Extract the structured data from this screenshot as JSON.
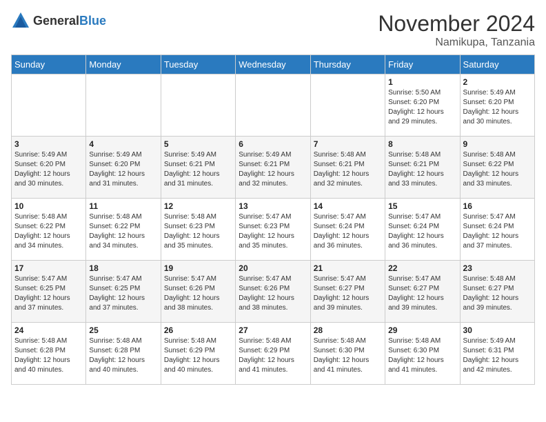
{
  "logo": {
    "general": "General",
    "blue": "Blue"
  },
  "title": "November 2024",
  "subtitle": "Namikupa, Tanzania",
  "days_header": [
    "Sunday",
    "Monday",
    "Tuesday",
    "Wednesday",
    "Thursday",
    "Friday",
    "Saturday"
  ],
  "weeks": [
    [
      {
        "day": "",
        "sunrise": "",
        "sunset": "",
        "daylight": ""
      },
      {
        "day": "",
        "sunrise": "",
        "sunset": "",
        "daylight": ""
      },
      {
        "day": "",
        "sunrise": "",
        "sunset": "",
        "daylight": ""
      },
      {
        "day": "",
        "sunrise": "",
        "sunset": "",
        "daylight": ""
      },
      {
        "day": "",
        "sunrise": "",
        "sunset": "",
        "daylight": ""
      },
      {
        "day": "1",
        "sunrise": "Sunrise: 5:50 AM",
        "sunset": "Sunset: 6:20 PM",
        "daylight": "Daylight: 12 hours and 29 minutes."
      },
      {
        "day": "2",
        "sunrise": "Sunrise: 5:49 AM",
        "sunset": "Sunset: 6:20 PM",
        "daylight": "Daylight: 12 hours and 30 minutes."
      }
    ],
    [
      {
        "day": "3",
        "sunrise": "Sunrise: 5:49 AM",
        "sunset": "Sunset: 6:20 PM",
        "daylight": "Daylight: 12 hours and 30 minutes."
      },
      {
        "day": "4",
        "sunrise": "Sunrise: 5:49 AM",
        "sunset": "Sunset: 6:20 PM",
        "daylight": "Daylight: 12 hours and 31 minutes."
      },
      {
        "day": "5",
        "sunrise": "Sunrise: 5:49 AM",
        "sunset": "Sunset: 6:21 PM",
        "daylight": "Daylight: 12 hours and 31 minutes."
      },
      {
        "day": "6",
        "sunrise": "Sunrise: 5:49 AM",
        "sunset": "Sunset: 6:21 PM",
        "daylight": "Daylight: 12 hours and 32 minutes."
      },
      {
        "day": "7",
        "sunrise": "Sunrise: 5:48 AM",
        "sunset": "Sunset: 6:21 PM",
        "daylight": "Daylight: 12 hours and 32 minutes."
      },
      {
        "day": "8",
        "sunrise": "Sunrise: 5:48 AM",
        "sunset": "Sunset: 6:21 PM",
        "daylight": "Daylight: 12 hours and 33 minutes."
      },
      {
        "day": "9",
        "sunrise": "Sunrise: 5:48 AM",
        "sunset": "Sunset: 6:22 PM",
        "daylight": "Daylight: 12 hours and 33 minutes."
      }
    ],
    [
      {
        "day": "10",
        "sunrise": "Sunrise: 5:48 AM",
        "sunset": "Sunset: 6:22 PM",
        "daylight": "Daylight: 12 hours and 34 minutes."
      },
      {
        "day": "11",
        "sunrise": "Sunrise: 5:48 AM",
        "sunset": "Sunset: 6:22 PM",
        "daylight": "Daylight: 12 hours and 34 minutes."
      },
      {
        "day": "12",
        "sunrise": "Sunrise: 5:48 AM",
        "sunset": "Sunset: 6:23 PM",
        "daylight": "Daylight: 12 hours and 35 minutes."
      },
      {
        "day": "13",
        "sunrise": "Sunrise: 5:47 AM",
        "sunset": "Sunset: 6:23 PM",
        "daylight": "Daylight: 12 hours and 35 minutes."
      },
      {
        "day": "14",
        "sunrise": "Sunrise: 5:47 AM",
        "sunset": "Sunset: 6:24 PM",
        "daylight": "Daylight: 12 hours and 36 minutes."
      },
      {
        "day": "15",
        "sunrise": "Sunrise: 5:47 AM",
        "sunset": "Sunset: 6:24 PM",
        "daylight": "Daylight: 12 hours and 36 minutes."
      },
      {
        "day": "16",
        "sunrise": "Sunrise: 5:47 AM",
        "sunset": "Sunset: 6:24 PM",
        "daylight": "Daylight: 12 hours and 37 minutes."
      }
    ],
    [
      {
        "day": "17",
        "sunrise": "Sunrise: 5:47 AM",
        "sunset": "Sunset: 6:25 PM",
        "daylight": "Daylight: 12 hours and 37 minutes."
      },
      {
        "day": "18",
        "sunrise": "Sunrise: 5:47 AM",
        "sunset": "Sunset: 6:25 PM",
        "daylight": "Daylight: 12 hours and 37 minutes."
      },
      {
        "day": "19",
        "sunrise": "Sunrise: 5:47 AM",
        "sunset": "Sunset: 6:26 PM",
        "daylight": "Daylight: 12 hours and 38 minutes."
      },
      {
        "day": "20",
        "sunrise": "Sunrise: 5:47 AM",
        "sunset": "Sunset: 6:26 PM",
        "daylight": "Daylight: 12 hours and 38 minutes."
      },
      {
        "day": "21",
        "sunrise": "Sunrise: 5:47 AM",
        "sunset": "Sunset: 6:27 PM",
        "daylight": "Daylight: 12 hours and 39 minutes."
      },
      {
        "day": "22",
        "sunrise": "Sunrise: 5:47 AM",
        "sunset": "Sunset: 6:27 PM",
        "daylight": "Daylight: 12 hours and 39 minutes."
      },
      {
        "day": "23",
        "sunrise": "Sunrise: 5:48 AM",
        "sunset": "Sunset: 6:27 PM",
        "daylight": "Daylight: 12 hours and 39 minutes."
      }
    ],
    [
      {
        "day": "24",
        "sunrise": "Sunrise: 5:48 AM",
        "sunset": "Sunset: 6:28 PM",
        "daylight": "Daylight: 12 hours and 40 minutes."
      },
      {
        "day": "25",
        "sunrise": "Sunrise: 5:48 AM",
        "sunset": "Sunset: 6:28 PM",
        "daylight": "Daylight: 12 hours and 40 minutes."
      },
      {
        "day": "26",
        "sunrise": "Sunrise: 5:48 AM",
        "sunset": "Sunset: 6:29 PM",
        "daylight": "Daylight: 12 hours and 40 minutes."
      },
      {
        "day": "27",
        "sunrise": "Sunrise: 5:48 AM",
        "sunset": "Sunset: 6:29 PM",
        "daylight": "Daylight: 12 hours and 41 minutes."
      },
      {
        "day": "28",
        "sunrise": "Sunrise: 5:48 AM",
        "sunset": "Sunset: 6:30 PM",
        "daylight": "Daylight: 12 hours and 41 minutes."
      },
      {
        "day": "29",
        "sunrise": "Sunrise: 5:48 AM",
        "sunset": "Sunset: 6:30 PM",
        "daylight": "Daylight: 12 hours and 41 minutes."
      },
      {
        "day": "30",
        "sunrise": "Sunrise: 5:49 AM",
        "sunset": "Sunset: 6:31 PM",
        "daylight": "Daylight: 12 hours and 42 minutes."
      }
    ]
  ]
}
